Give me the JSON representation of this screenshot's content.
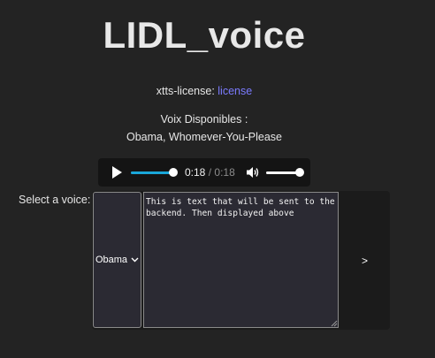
{
  "page": {
    "title": "LIDL_voice"
  },
  "license": {
    "prefix": "xtts-license:",
    "link_label": "license"
  },
  "voices": {
    "heading": "Voix Disponibles :",
    "list": "Obama, Whomever-You-Please"
  },
  "player": {
    "current_time": "0:18",
    "separator": "/",
    "duration": "0:18",
    "progress_fraction": 1.0,
    "volume_fraction": 1.0,
    "play_icon": "play-icon",
    "volume_icon": "speaker-icon"
  },
  "form": {
    "select_label": "Select a voice:",
    "selected_voice": "Obama",
    "text_value": "This is text that will be sent to the backend. Then displayed above",
    "submit_label": ">"
  },
  "colors": {
    "background": "#232323",
    "link": "#7b7bff",
    "progress_fill": "#1aa7d9",
    "field_background": "#2b2a33"
  }
}
